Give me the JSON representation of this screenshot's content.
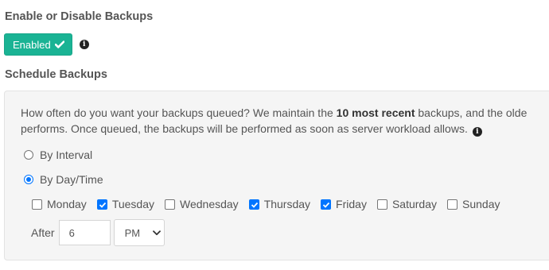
{
  "backups": {
    "enable_title": "Enable or Disable Backups",
    "enabled_label": "Enabled",
    "schedule_title": "Schedule Backups",
    "description": {
      "part1": "How often do you want your backups queued? We maintain the ",
      "bold": "10 most recent",
      "part2": " backups, and the olde",
      "line2": "performs. Once queued, the backups will be performed as soon as server workload allows."
    },
    "radios": [
      {
        "label": "By Interval",
        "checked": false
      },
      {
        "label": "By Day/Time",
        "checked": true
      }
    ],
    "days": [
      {
        "label": "Monday",
        "checked": false
      },
      {
        "label": "Tuesday",
        "checked": true
      },
      {
        "label": "Wednesday",
        "checked": false
      },
      {
        "label": "Thursday",
        "checked": true
      },
      {
        "label": "Friday",
        "checked": true
      },
      {
        "label": "Saturday",
        "checked": false
      },
      {
        "label": "Sunday",
        "checked": false
      }
    ],
    "after_label": "After",
    "after_hour": "6",
    "after_period": "PM"
  },
  "colors": {
    "accent": "#1ab394",
    "checkbox": "#0075ff",
    "panel_bg": "#f5f5f5"
  },
  "icons": {
    "enabled": "check-icon",
    "info": "info-circle-icon",
    "select": "chevron-down-icon"
  }
}
